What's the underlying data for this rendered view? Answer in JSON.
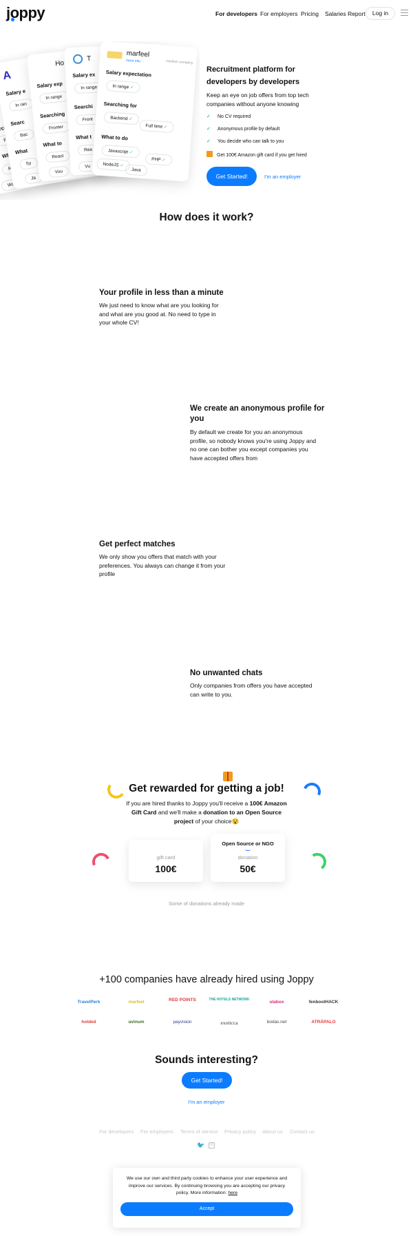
{
  "nav": {
    "logo": "joppy",
    "links": [
      "For developers",
      "For employers",
      "Pricing",
      "Salaries Report"
    ],
    "login": "Log in"
  },
  "hero": {
    "cards": [
      {
        "company": "Ho",
        "company_sub": "",
        "salary_label": "Salary exp",
        "salary_value": "In range",
        "searching_label": "Searching",
        "searching_values": [
          "Fronter"
        ],
        "todo_label": "What to",
        "todo_values": [
          "React",
          "Vuu"
        ]
      },
      {
        "company": "T",
        "company_sub": "",
        "salary_label": "Salary ex",
        "salary_value": "In range",
        "searching_label": "Searchi",
        "searching_values": [
          "Front"
        ],
        "todo_label": "What t",
        "todo_values": [
          "Rea",
          "Vu"
        ]
      },
      {
        "company": "marfeel",
        "company_sub": "more info",
        "company_size": "medium company",
        "salary_label": "Salary expectation",
        "salary_value": "In range",
        "searching_label": "Searching for",
        "searching_values": [
          "Backend",
          "Full time"
        ],
        "todo_label": "What to do",
        "todo_values": [
          "Javascript",
          "PHP",
          "NodeJS",
          "Java"
        ]
      }
    ],
    "back_cards": {
      "a": {
        "logo": "A",
        "salary": "Salary e",
        "salary_value": "In ran",
        "search": "Searc",
        "search_value": "Bac",
        "todo": "What",
        "todo_values": [
          "Sy",
          "Ja"
        ]
      },
      "b": {
        "e": "e:",
        "rch": "rch",
        "fullt": "Fullt",
        "what": "What",
        "re": "Re",
        "wo": "Wo"
      }
    },
    "title": "Recruitment platform for developers by developers",
    "subtitle": "Keep an eye on job offers from top tech companies without anyone knowing",
    "features": [
      "No CV required",
      "Anonymous profile by default",
      "You decide who can talk to you",
      "Get 100€ Amazon gift card if you get hired"
    ],
    "cta_primary": "Get Started!",
    "cta_secondary": "I'm an employer"
  },
  "how": {
    "title": "How does it work?",
    "steps": [
      {
        "title": "Your profile in less than a minute",
        "text": "We just need to know what are you looking for and what are you good at. No need to type in your whole CV!"
      },
      {
        "title": "We create an anonymous profile for you",
        "text": "By default we create for you an anonymous profile, so nobody knows you're using Joppy and no one can bother you except companies you have accepted offers from"
      },
      {
        "title": "Get perfect matches",
        "text": "We only show you offers that match with your preferences. You always can change it from your profile"
      },
      {
        "title": "No unwanted chats",
        "text": "Only companies from offers you have accepted can write to you."
      }
    ]
  },
  "reward": {
    "title": "Get rewarded for getting a job!",
    "text_1": "If you are hired thanks to Joppy you'll receive a ",
    "text_bold_1": "100€ Amazon Gift Card",
    "text_2": " and we'll make a ",
    "text_bold_2": "donation to an Open Source project",
    "text_3": " of your choice",
    "emoji": "😵",
    "card_gift": {
      "label": "gift card",
      "value": "100€"
    },
    "card_donation": {
      "header": "Open Source or NGO",
      "label": "donation",
      "value": "50€"
    },
    "donations_note": "Some of donations already made",
    "colors": {
      "yellow": "#f5c518",
      "blue": "#1a7bff",
      "red": "#ef4e6c",
      "green": "#3ecf6b"
    }
  },
  "companies": {
    "title": "+100 companies have already hired using Joppy",
    "row1": [
      "TravelPerk",
      "marfeel",
      "RED POINTS",
      "THE HOTELS NETWORK",
      "ulabox",
      "fenbootHACK"
    ],
    "row2": [
      "holded",
      "uvinum",
      "payvision",
      "exoticca",
      "bodas.net",
      "ATRÁPALO"
    ]
  },
  "final": {
    "title": "Sounds interesting?",
    "cta_primary": "Get Started!",
    "cta_secondary": "I'm an employer"
  },
  "footer": {
    "links": [
      "For developers",
      "For employers",
      "Terms of service",
      "Privacy policy",
      "About us",
      "Contact us"
    ],
    "social": [
      "twitter-icon",
      "linkedin-icon"
    ]
  },
  "cookie": {
    "text": "We use our own and third party cookies to enhance your user experience and improve our services. By continuing browsing you are accepting our privacy policy. More information: ",
    "link": "here",
    "accept": "Accept"
  }
}
